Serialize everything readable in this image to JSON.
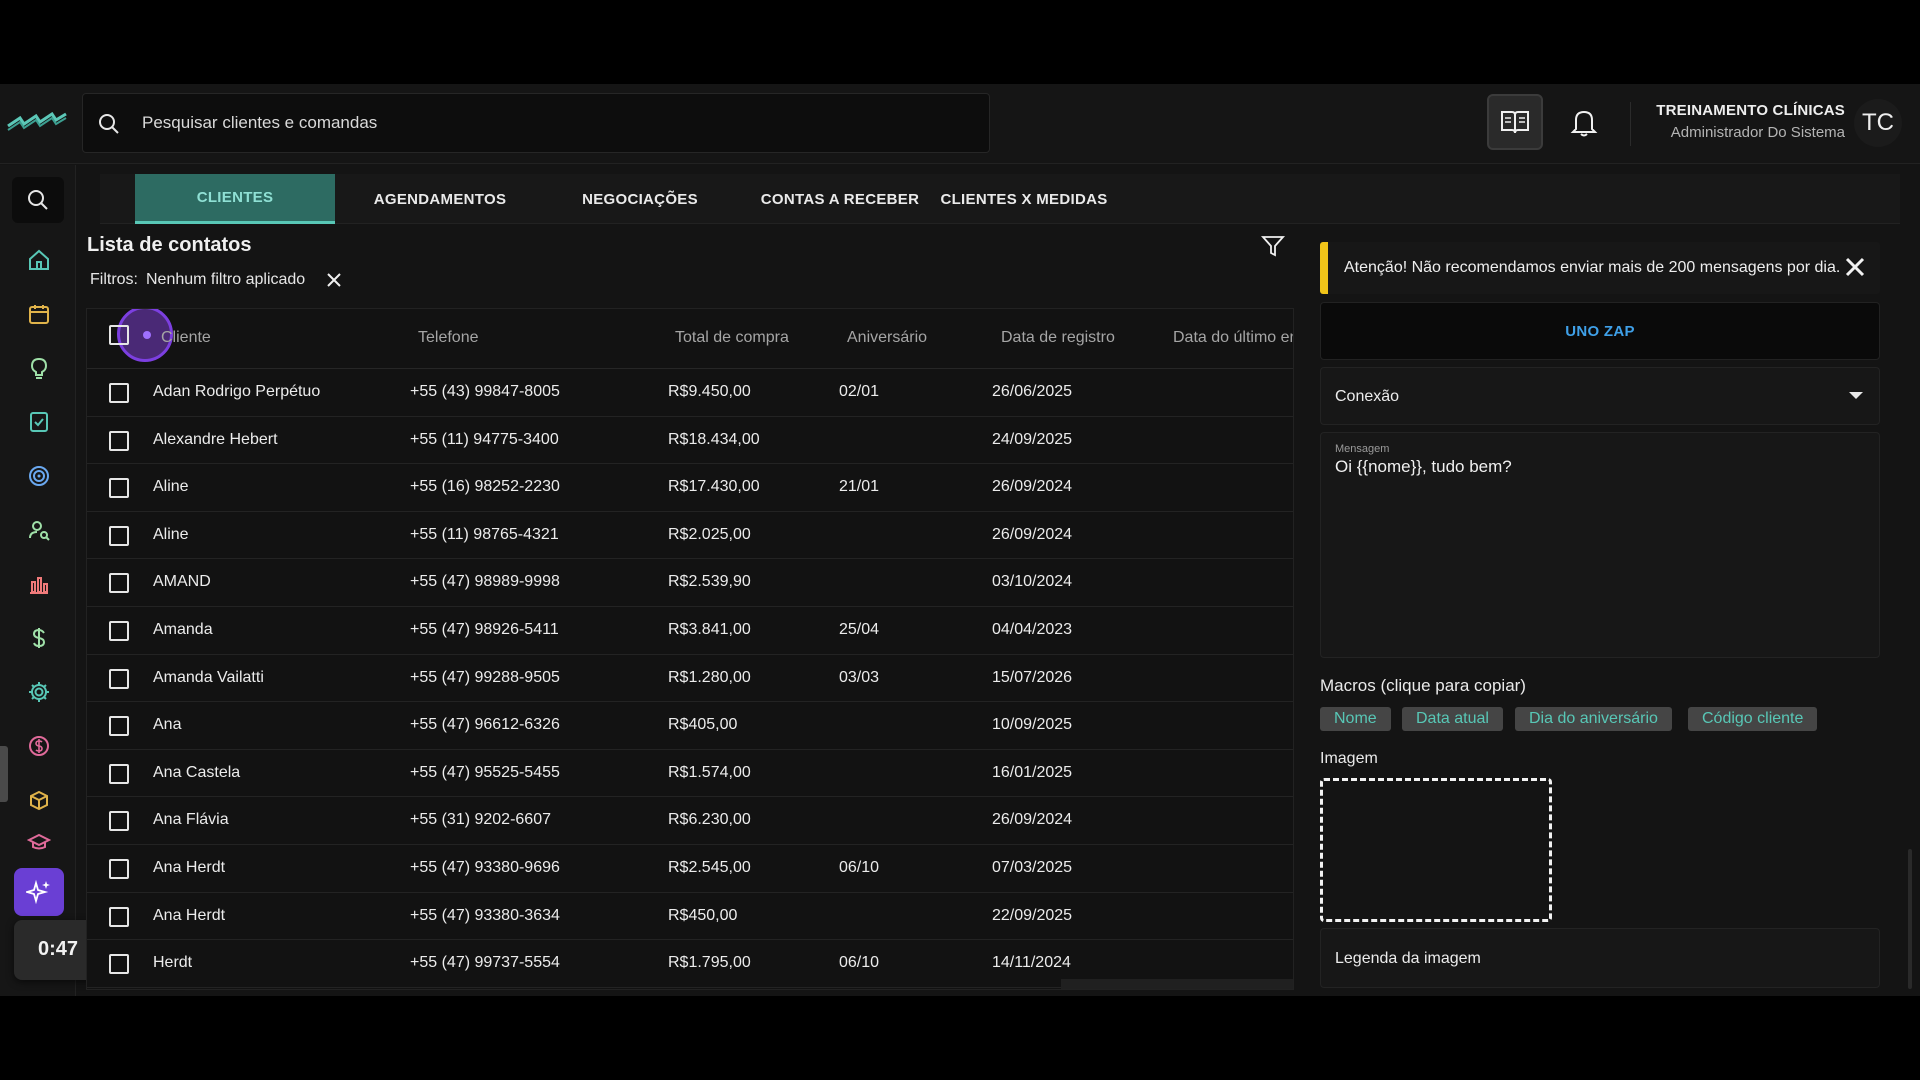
{
  "search": {
    "placeholder": "Pesquisar clientes e comandas"
  },
  "user": {
    "name": "TREINAMENTO CLÍNICAS",
    "role": "Administrador Do Sistema",
    "initials": "TC"
  },
  "tabs": [
    {
      "label": "CLIENTES",
      "active": true
    },
    {
      "label": "AGENDAMENTOS"
    },
    {
      "label": "NEGOCIAÇÕES"
    },
    {
      "label": "CONTAS A RECEBER"
    },
    {
      "label": "CLIENTES X MEDIDAS"
    }
  ],
  "list": {
    "title": "Lista de contatos",
    "filters_label": "Filtros:",
    "filters_value": "Nenhum filtro aplicado"
  },
  "table": {
    "headers": [
      "Cliente",
      "Telefone",
      "Total de compra",
      "Aniversário",
      "Data de registro",
      "Data do último en"
    ],
    "rows": [
      {
        "name": "Adan Rodrigo Perpétuo",
        "phone": "+55 (43) 99847-8005",
        "total": "R$9.450,00",
        "birthday": "02/01",
        "registered": "26/06/2025"
      },
      {
        "name": "Alexandre Hebert",
        "phone": "+55 (11) 94775-3400",
        "total": "R$18.434,00",
        "birthday": "",
        "registered": "24/09/2025"
      },
      {
        "name": "Aline",
        "phone": "+55 (16) 98252-2230",
        "total": "R$17.430,00",
        "birthday": "21/01",
        "registered": "26/09/2024"
      },
      {
        "name": "Aline",
        "phone": "+55 (11) 98765-4321",
        "total": "R$2.025,00",
        "birthday": "",
        "registered": "26/09/2024"
      },
      {
        "name": "AMAND",
        "phone": "+55 (47) 98989-9998",
        "total": "R$2.539,90",
        "birthday": "",
        "registered": "03/10/2024"
      },
      {
        "name": "Amanda",
        "phone": "+55 (47) 98926-5411",
        "total": "R$3.841,00",
        "birthday": "25/04",
        "registered": "04/04/2023"
      },
      {
        "name": "Amanda Vailatti",
        "phone": "+55 (47) 99288-9505",
        "total": "R$1.280,00",
        "birthday": "03/03",
        "registered": "15/07/2026"
      },
      {
        "name": "Ana",
        "phone": "+55 (47) 96612-6326",
        "total": "R$405,00",
        "birthday": "",
        "registered": "10/09/2025"
      },
      {
        "name": "Ana Castela",
        "phone": "+55 (47) 95525-5455",
        "total": "R$1.574,00",
        "birthday": "",
        "registered": "16/01/2025"
      },
      {
        "name": "Ana Flávia",
        "phone": "+55 (31) 9202-6607",
        "total": "R$6.230,00",
        "birthday": "",
        "registered": "26/09/2024"
      },
      {
        "name": "Ana Herdt",
        "phone": "+55 (47) 93380-9696",
        "total": "R$2.545,00",
        "birthday": "06/10",
        "registered": "07/03/2025"
      },
      {
        "name": "Ana Herdt",
        "phone": "+55 (47) 93380-3634",
        "total": "R$450,00",
        "birthday": "",
        "registered": "22/09/2025"
      },
      {
        "name": "Herdt",
        "phone": "+55 (47) 99737-5554",
        "total": "R$1.795,00",
        "birthday": "06/10",
        "registered": "14/11/2024"
      }
    ]
  },
  "panel": {
    "warning": "Atenção! Não recomendamos enviar mais de 200 mensagens por dia.",
    "provider_button": "UNO ZAP",
    "connection_label": "Conexão",
    "message_caption": "Mensagem",
    "message_value": "Oi {{nome}}, tudo bem?",
    "macros_title": "Macros (clique para copiar)",
    "macros": [
      "Nome",
      "Data atual",
      "Dia do aniversário",
      "Código cliente"
    ],
    "image_label": "Imagem",
    "caption_placeholder": "Legenda da imagem"
  },
  "recorder": {
    "time": "0:47"
  },
  "colors": {
    "accent": "#58c7b6",
    "tab_active_bg": "#2d6b62",
    "warning": "#f0c419",
    "ai_button": "#6a3fd4",
    "link_blue": "#3fa0e8"
  }
}
